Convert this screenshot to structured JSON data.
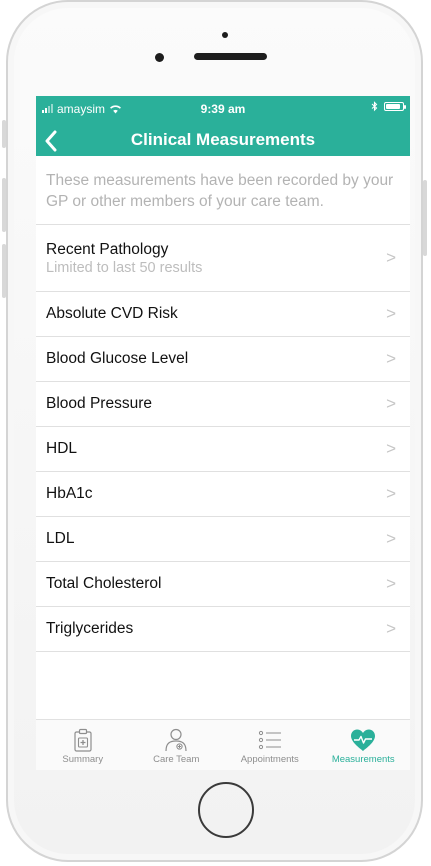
{
  "status": {
    "carrier": "amaysim",
    "time": "9:39 am",
    "wifi_icon": "wifi-icon",
    "bluetooth_icon": "bluetooth-icon",
    "battery_level": 0.9
  },
  "nav": {
    "title": "Clinical Measurements",
    "back_icon": "chevron-left-icon"
  },
  "intro": "These measurements have been recorded by your GP or other members of your care team.",
  "items": [
    {
      "label": "Recent Pathology",
      "sub": "Limited to last 50 results"
    },
    {
      "label": "Absolute CVD Risk"
    },
    {
      "label": "Blood Glucose Level"
    },
    {
      "label": "Blood Pressure"
    },
    {
      "label": "HDL"
    },
    {
      "label": "HbA1c"
    },
    {
      "label": "LDL"
    },
    {
      "label": "Total Cholesterol"
    },
    {
      "label": "Triglycerides"
    }
  ],
  "chevron": ">",
  "tabs": [
    {
      "label": "Summary",
      "icon": "clipboard-icon",
      "active": false
    },
    {
      "label": "Care Team",
      "icon": "doctor-icon",
      "active": false
    },
    {
      "label": "Appointments",
      "icon": "list-icon",
      "active": false
    },
    {
      "label": "Measurements",
      "icon": "heart-pulse-icon",
      "active": true
    }
  ],
  "colors": {
    "accent": "#2ab09a",
    "inactive": "#8e8e8e"
  }
}
